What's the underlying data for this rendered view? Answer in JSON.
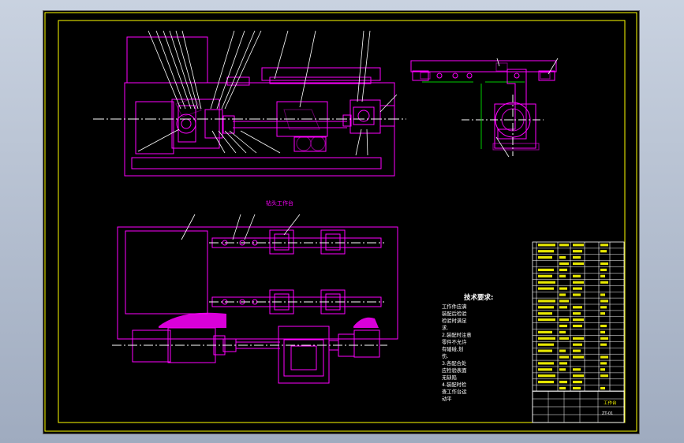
{
  "drawing": {
    "section_title": "钻头工作台",
    "tech_req_title": "技术要求:",
    "tech_req_lines": [
      "工作件应满",
      "装配后检验",
      "检验时满足",
      "求.",
      "2.装配时注意",
      "零件不允许",
      "有磕碰,划",
      "伤.",
      "3.各配合处",
      "应检验表面",
      "无缺陷",
      "4.装配时检",
      "查工作台运",
      "动平"
    ],
    "title_block_name": "工作台",
    "title_block_code": "ZT-01"
  },
  "colors": {
    "outline": "#ffff00",
    "parts": "#ff00ff",
    "centerline": "#ffffff",
    "dimension": "#00cc00",
    "background": "#000000"
  }
}
